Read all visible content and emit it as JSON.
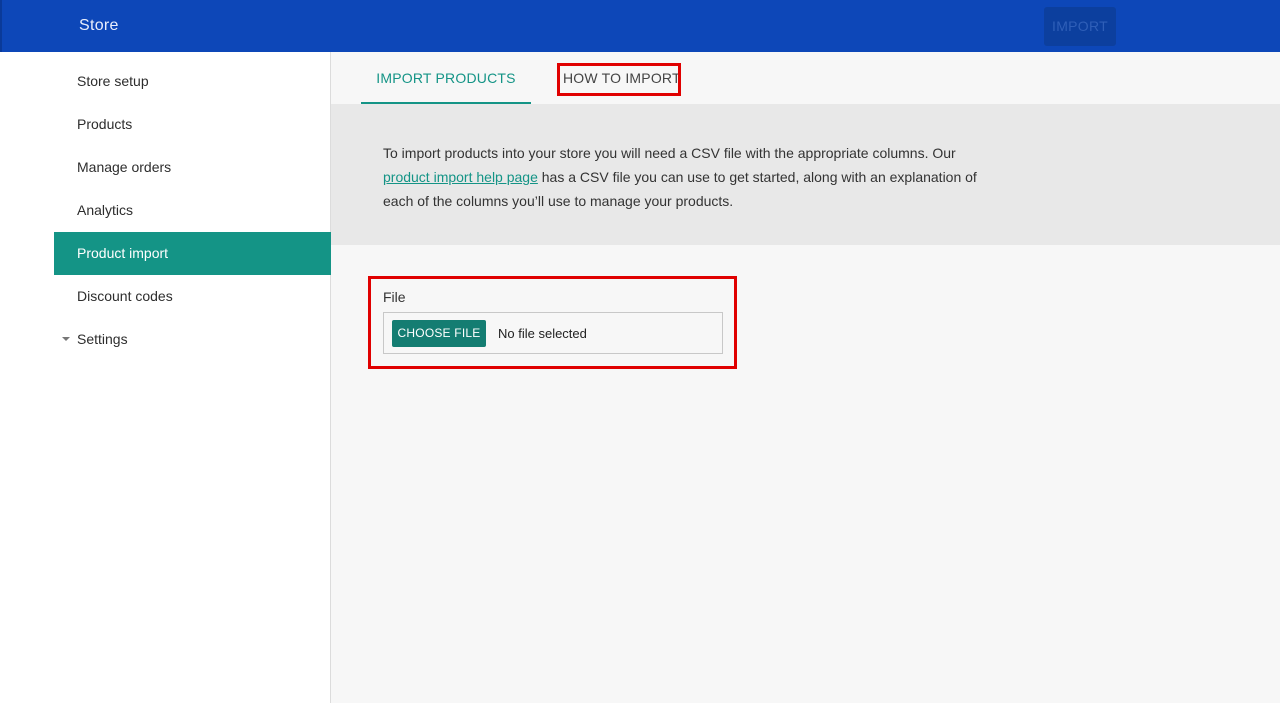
{
  "header": {
    "title": "Store",
    "import_label": "IMPORT"
  },
  "sidebar": {
    "items": [
      {
        "label": "Store setup"
      },
      {
        "label": "Products"
      },
      {
        "label": "Manage orders"
      },
      {
        "label": "Analytics"
      },
      {
        "label": "Product import"
      },
      {
        "label": "Discount codes"
      },
      {
        "label": "Settings"
      }
    ]
  },
  "tabs": {
    "import_products": "IMPORT PRODUCTS",
    "how_to_import": "HOW TO IMPORT"
  },
  "info": {
    "text_before": "To import products into your store you will need a CSV file with the appropriate columns. Our ",
    "link": "product import help page",
    "text_after": " has a CSV file you can use to get started, along with an explanation of each of the columns you’ll use to manage your products."
  },
  "file_field": {
    "label": "File",
    "button_label": "CHOOSE FILE",
    "status": "No file selected"
  },
  "colors": {
    "header_bg": "#0d47b8",
    "accent": "#149486",
    "highlight": "#e00000"
  }
}
